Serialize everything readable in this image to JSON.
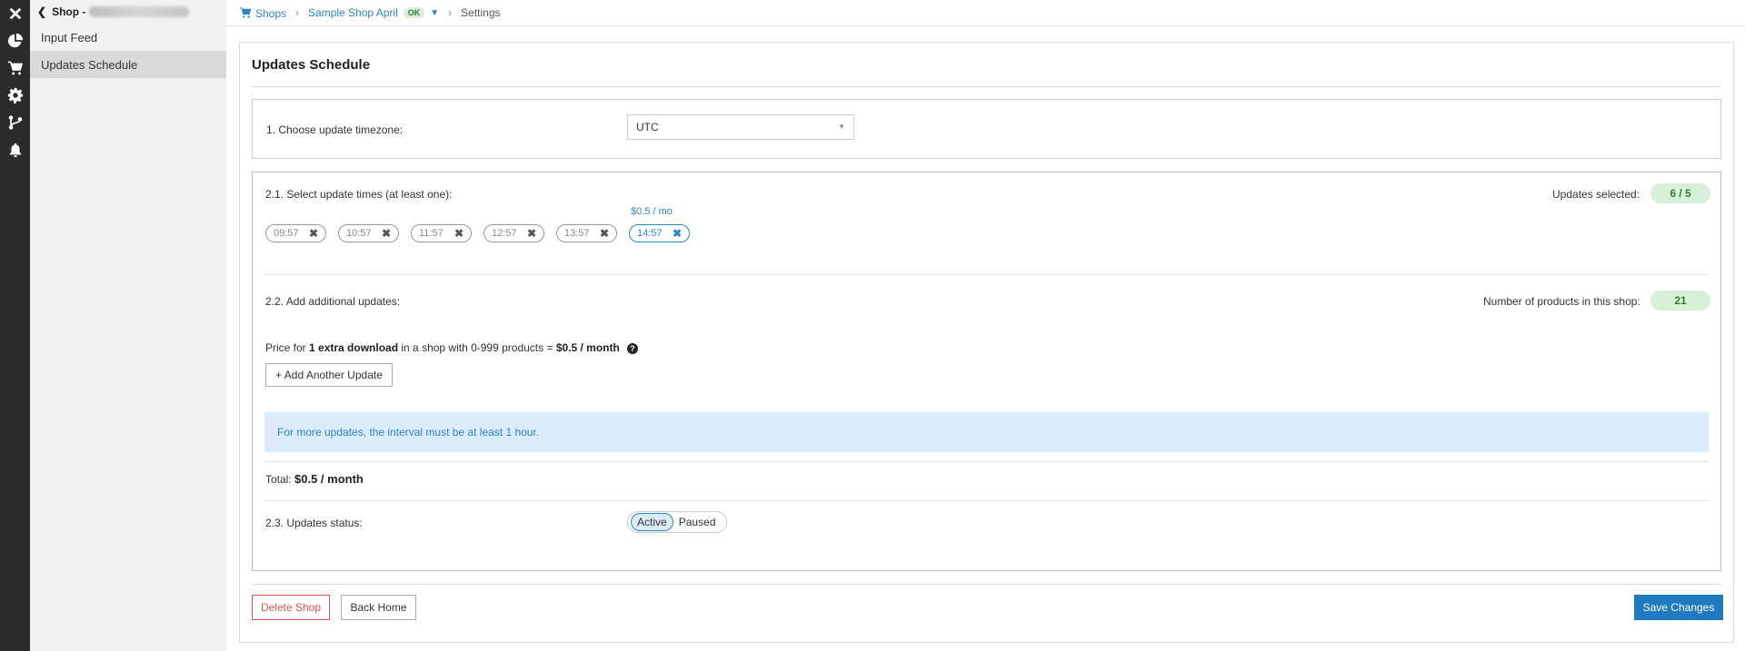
{
  "sidebar": {
    "shop_prefix": "Shop -",
    "items": [
      {
        "label": "Input Feed"
      },
      {
        "label": "Updates Schedule"
      }
    ]
  },
  "breadcrumb": {
    "shops": "Shops",
    "shop_name": "Sample Shop April",
    "status": "OK",
    "current": "Settings"
  },
  "page": {
    "title": "Updates Schedule"
  },
  "timezone": {
    "label": "1. Choose update timezone:",
    "value": "UTC"
  },
  "times": {
    "label": "2.1. Select update times (at least one):",
    "updates_selected_label": "Updates selected:",
    "updates_selected_value": "6 / 5",
    "extra_price": "$0.5 / mo",
    "chips": [
      "09:57",
      "10:57",
      "11:57",
      "12:57",
      "13:57",
      "14:57"
    ]
  },
  "additional": {
    "label": "2.2. Add additional updates:",
    "products_label": "Number of products in this shop:",
    "products_value": "21",
    "price_prefix": "Price for ",
    "price_bold1": "1 extra download",
    "price_middle": " in a shop with 0-999 products = ",
    "price_bold2": "$0.5 / month",
    "help_glyph": "?",
    "add_button": "+ Add Another Update",
    "info": "For more updates, the interval must be at least 1 hour."
  },
  "total": {
    "label": "Total: ",
    "value": "$0.5 / month"
  },
  "status": {
    "label": "2.3. Updates status:",
    "active": "Active",
    "paused": "Paused"
  },
  "footer": {
    "delete": "Delete Shop",
    "back": "Back Home",
    "save": "Save Changes"
  },
  "icons": [
    "close-icon",
    "pie-chart-icon",
    "cart-icon",
    "gear-icon",
    "branch-icon",
    "bell-icon",
    "chevron-left-icon",
    "caret-down-icon",
    "remove-icon",
    "help-icon"
  ],
  "colors": {
    "rail": "#2b2b2b",
    "accent": "#1f7abf",
    "link": "#2e86c1",
    "success_bg": "#d7f0d7",
    "success_text": "#2e7d32",
    "danger": "#d9534f",
    "info_bg": "#dcebfa"
  }
}
